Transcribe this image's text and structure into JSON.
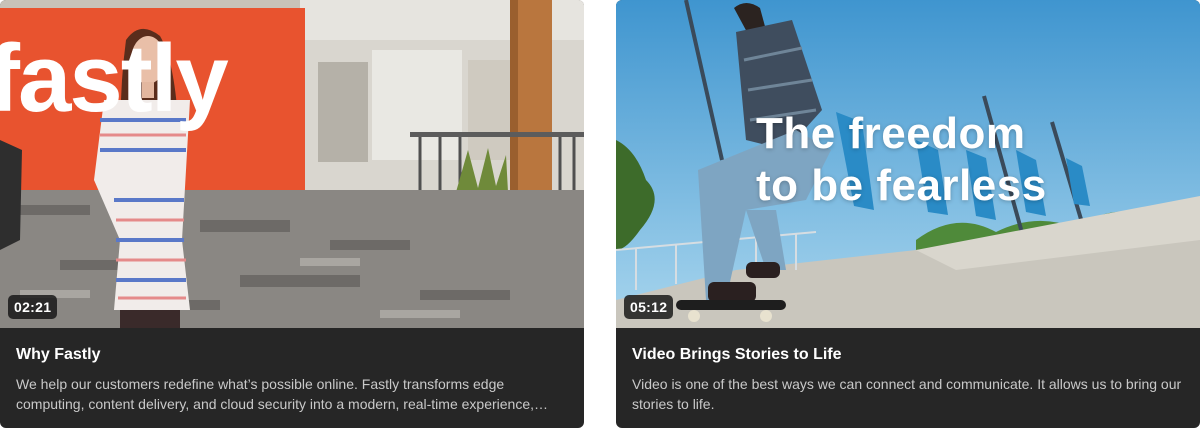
{
  "videos": [
    {
      "duration": "02:21",
      "title": "Why Fastly",
      "description": "We help our customers redefine what’s possible online. Fastly transforms edge computing, content delivery, and cloud security into a modern, real-time experience, providing fast…",
      "logo_text": "fastly"
    },
    {
      "duration": "05:12",
      "title": "Video Brings Stories to Life",
      "description": "Video is one of the best ways we can connect and communicate. It allows us to bring our stories to life.",
      "overlay_line1": "The freedom",
      "overlay_line2": "to be fearless"
    }
  ],
  "colors": {
    "card_bg": "#262626",
    "title": "#ffffff",
    "description": "#c9c9c9",
    "brand_orange": "#e8532f",
    "sky": "#4aa3d8"
  }
}
